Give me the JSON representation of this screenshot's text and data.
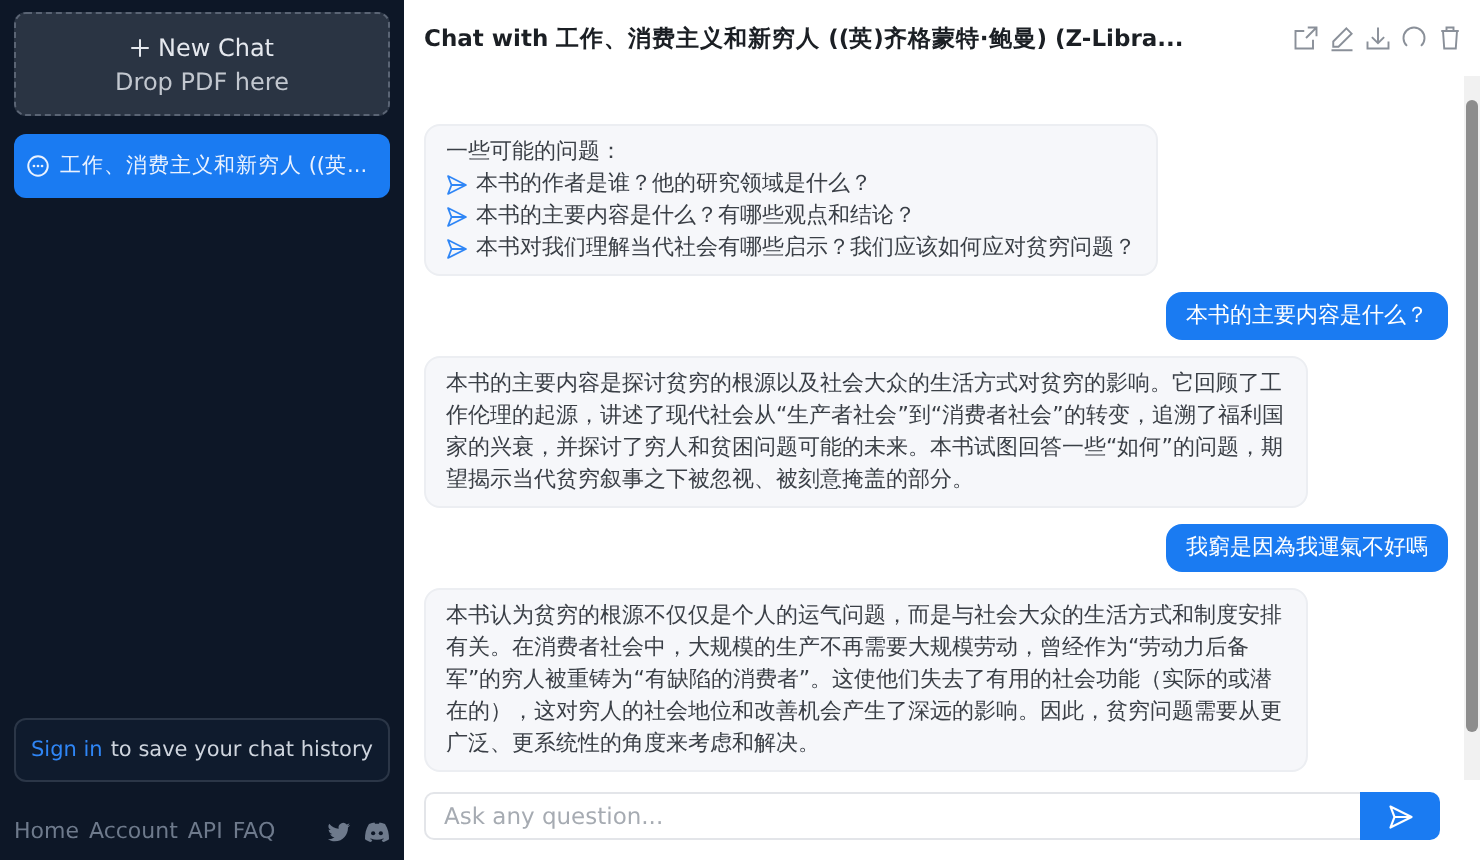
{
  "sidebar": {
    "new_chat": {
      "label": "New Chat",
      "hint": "Drop PDF here"
    },
    "chats": [
      {
        "title": "工作、消费主义和新穷人 ((英...",
        "selected": true
      }
    ],
    "sign_in": {
      "link": "Sign in",
      "text": "to save your chat history"
    },
    "footer_links": [
      "Home",
      "Account",
      "API",
      "FAQ"
    ]
  },
  "header": {
    "title": "Chat with 工作、消费主义和新穷人 ((英)齐格蒙特·鲍曼) (Z-Libra..."
  },
  "messages": [
    {
      "kind": "suggestions",
      "intro": "一些可能的问题：",
      "suggestions": [
        "本书的作者是谁？他的研究领域是什么？",
        "本书的主要内容是什么？有哪些观点和结论？",
        "本书对我们理解当代社会有哪些启示？我们应该如何应对贫穷问题？"
      ]
    },
    {
      "kind": "question",
      "text": "本书的主要内容是什么？"
    },
    {
      "kind": "answer",
      "text": "本书的主要内容是探讨贫穷的根源以及社会大众的生活方式对贫穷的影响。它回顾了工作伦理的起源，讲述了现代社会从“生产者社会”到“消费者社会”的转变，追溯了福利国家的兴衰，并探讨了穷人和贫困问题可能的未来。本书试图回答一些“如何”的问题，期望揭示当代贫穷叙事之下被忽视、被刻意掩盖的部分。"
    },
    {
      "kind": "question",
      "text": "我窮是因為我運氣不好嗎"
    },
    {
      "kind": "answer",
      "text": "本书认为贫穷的根源不仅仅是个人的运气问题，而是与社会大众的生活方式和制度安排有关。在消费者社会中，大规模的生产不再需要大规模劳动，曾经作为“劳动力后备军”的穷人被重铸为“有缺陷的消费者”。这使他们失去了有用的社会功能（实际的或潜在的），这对穷人的社会地位和改善机会产生了深远的影响。因此，贫穷问题需要从更广泛、更系统性的角度来考虑和解决。"
    }
  ],
  "input": {
    "placeholder": "Ask any question..."
  }
}
